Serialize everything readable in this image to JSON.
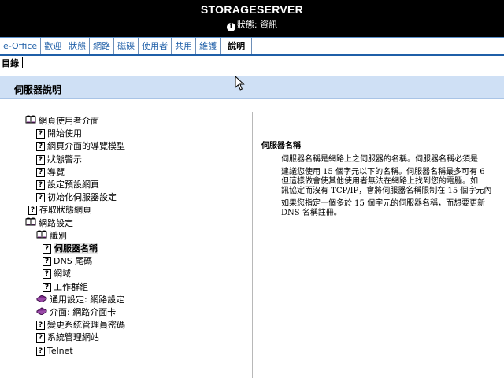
{
  "header": {
    "server_name": "STORAGESERVER",
    "status_label": "狀態: 資訊",
    "status_icon": "info-icon"
  },
  "tabs": [
    {
      "label": "e-Office",
      "active": false
    },
    {
      "label": "歡迎",
      "active": false
    },
    {
      "label": "狀態",
      "active": false
    },
    {
      "label": "網路",
      "active": false
    },
    {
      "label": "磁碟",
      "active": false
    },
    {
      "label": "使用者",
      "active": false
    },
    {
      "label": "共用",
      "active": false
    },
    {
      "label": "維護",
      "active": false
    },
    {
      "label": "說明",
      "active": true
    }
  ],
  "toc": {
    "label": "目錄"
  },
  "section": {
    "title": "伺服器說明"
  },
  "tree": {
    "items": [
      {
        "label": "網頁使用者介面",
        "icon": "book-open-icon",
        "level": 0
      },
      {
        "label": "開始使用",
        "icon": "help-page-icon",
        "level": 1
      },
      {
        "label": "網頁介面的導覽模型",
        "icon": "help-page-icon",
        "level": 1
      },
      {
        "label": "狀態警示",
        "icon": "help-page-icon",
        "level": 1
      },
      {
        "label": "導覽",
        "icon": "help-page-icon",
        "level": 1
      },
      {
        "label": "設定預設網頁",
        "icon": "help-page-icon",
        "level": 1
      },
      {
        "label": "初始化伺服器設定",
        "icon": "help-page-icon",
        "level": 1
      },
      {
        "label": "存取狀態網頁",
        "icon": "help-page-icon",
        "level": 0
      },
      {
        "label": "網路設定",
        "icon": "book-open-icon",
        "level": 0
      },
      {
        "label": "識別",
        "icon": "book-open-icon",
        "level": 1
      },
      {
        "label": "伺服器名稱",
        "icon": "help-page-icon",
        "level": 2,
        "selected": true
      },
      {
        "label": "DNS 尾碼",
        "icon": "help-page-icon",
        "level": 2
      },
      {
        "label": "網域",
        "icon": "help-page-icon",
        "level": 2
      },
      {
        "label": "工作群組",
        "icon": "help-page-icon",
        "level": 2
      },
      {
        "label": "通用設定: 網路設定",
        "icon": "book-closed-icon",
        "level": 1
      },
      {
        "label": "介面: 網路介面卡",
        "icon": "book-closed-icon",
        "level": 1
      },
      {
        "label": "變更系統管理員密碼",
        "icon": "help-page-icon",
        "level": 1
      },
      {
        "label": "系統管理網站",
        "icon": "help-page-icon",
        "level": 1
      },
      {
        "label": "Telnet",
        "icon": "help-page-icon",
        "level": 1
      }
    ]
  },
  "content": {
    "title": "伺服器名稱",
    "paragraphs": [
      [
        "伺服器名稱是網路上之伺服器的名稱。伺服器名稱必須是"
      ],
      [
        "建議您使用 15 個字元以下的名稱。伺服器名稱最多可有 6",
        "但這樣做會使其他使用者無法在網路上找到您的電腦。如",
        "訊協定而沒有 TCP/IP，會將伺服器名稱限制在 15 個字元內"
      ],
      [
        "如果您指定一個多於 15 個字元的伺服器名稱，而想要更新",
        "DNS 名稱註冊。"
      ]
    ]
  },
  "colors": {
    "header_bg": "#000000",
    "tab_link": "#1f5fa8",
    "section_bg": "#cfe0f5",
    "book_closed": "#7b2a8a"
  }
}
